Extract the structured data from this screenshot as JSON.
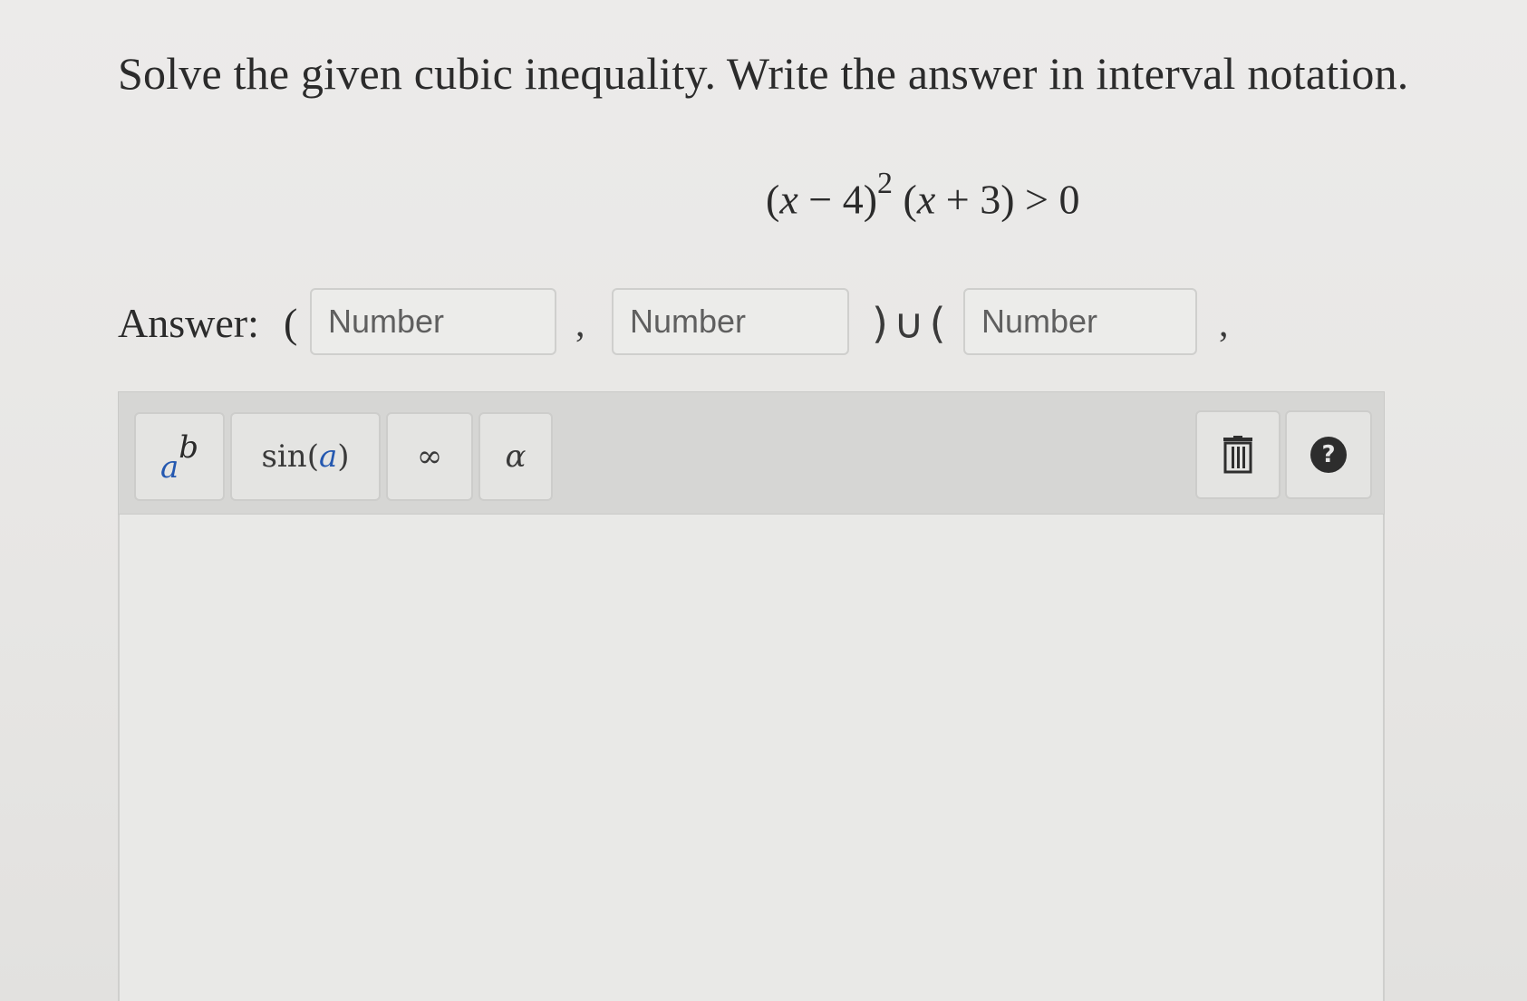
{
  "question": {
    "text": "Solve the given cubic inequality. Write the answer in interval notation."
  },
  "equation": {
    "open1": "(",
    "var1": "x",
    "minus": " − 4)",
    "exponent": "2",
    "open2": " (",
    "var2": "x",
    "plus": " + 3) > 0"
  },
  "answer": {
    "label": "Answer:",
    "open_paren": "(",
    "comma1": ",",
    "union": ")∪(",
    "comma2": ",",
    "inputs": [
      {
        "placeholder": "Number",
        "value": ""
      },
      {
        "placeholder": "Number",
        "value": ""
      },
      {
        "placeholder": "Number",
        "value": ""
      }
    ]
  },
  "toolbar": {
    "power_base": "a",
    "power_exp": "b",
    "sin_fn": "sin",
    "sin_open": " (",
    "sin_arg": "a",
    "sin_close": ")",
    "infinity": "∞",
    "alpha": "α",
    "help": "?",
    "icons": [
      "power-icon",
      "trash-icon",
      "help-icon"
    ]
  }
}
